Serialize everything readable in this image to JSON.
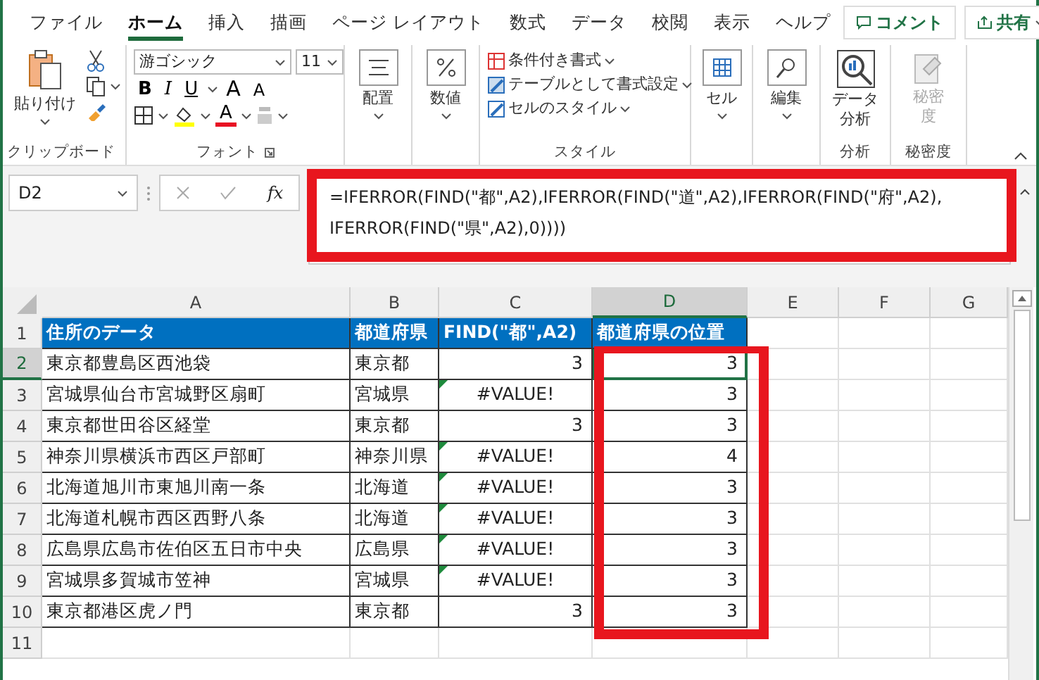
{
  "menu_tabs": [
    {
      "label": "ファイル",
      "selected": false
    },
    {
      "label": "ホーム",
      "selected": true
    },
    {
      "label": "挿入",
      "selected": false
    },
    {
      "label": "描画",
      "selected": false
    },
    {
      "label": "ページ レイアウト",
      "selected": false
    },
    {
      "label": "数式",
      "selected": false
    },
    {
      "label": "データ",
      "selected": false
    },
    {
      "label": "校閲",
      "selected": false
    },
    {
      "label": "表示",
      "selected": false
    },
    {
      "label": "ヘルプ",
      "selected": false
    }
  ],
  "comment_button": "コメント",
  "share_button": "共有",
  "ribbon": {
    "clipboard": {
      "paste_label": "貼り付け",
      "group_label": "クリップボード"
    },
    "font": {
      "font_name": "游ゴシック",
      "font_size": "11",
      "bold": "B",
      "italic": "I",
      "underline": "U",
      "grow": "A",
      "shrink": "A",
      "font_color": "A",
      "group_label": "フォント"
    },
    "alignment": {
      "label": "配置"
    },
    "number": {
      "label": "数値"
    },
    "styles": {
      "items": [
        "条件付き書式",
        "テーブルとして書式設定",
        "セルのスタイル"
      ],
      "group_label": "スタイル"
    },
    "cells": {
      "label": "セル"
    },
    "editing": {
      "label": "編集"
    },
    "analysis": {
      "label_lines": [
        "データ",
        "分析"
      ],
      "group_label": "分析"
    },
    "sensitivity": {
      "label_lines": [
        "秘密",
        "度"
      ],
      "disabled": true,
      "group_label": "秘密度"
    }
  },
  "formula_bar": {
    "name_box": "D2",
    "fx": "fx",
    "formula_lines": [
      "=IFERROR(FIND(\"都\",A2),IFERROR(FIND(\"道\",A2),IFERROR(FIND(\"府\",A2),",
      "IFERROR(FIND(\"県\",A2),0))))"
    ]
  },
  "grid": {
    "columns": [
      {
        "label": "A",
        "selected": false
      },
      {
        "label": "B",
        "selected": false
      },
      {
        "label": "C",
        "selected": false
      },
      {
        "label": "D",
        "selected": true
      },
      {
        "label": "E",
        "selected": false
      },
      {
        "label": "F",
        "selected": false
      },
      {
        "label": "G",
        "selected": false
      }
    ],
    "rows": [
      {
        "header": "1",
        "selected": false,
        "cells": [
          {
            "text": "住所のデータ",
            "kind": "header",
            "flag": false
          },
          {
            "text": "都道府県",
            "kind": "header",
            "flag": false
          },
          {
            "text": "FIND(\"都\",A2)",
            "kind": "header",
            "flag": false
          },
          {
            "text": "都道府県の位置",
            "kind": "header",
            "flag": false
          }
        ]
      },
      {
        "header": "2",
        "selected": true,
        "cells": [
          {
            "text": "東京都豊島区西池袋",
            "kind": "text",
            "flag": false
          },
          {
            "text": "東京都",
            "kind": "text",
            "flag": false
          },
          {
            "text": "3",
            "kind": "number",
            "flag": false
          },
          {
            "text": "3",
            "kind": "number",
            "flag": false
          }
        ]
      },
      {
        "header": "3",
        "selected": false,
        "cells": [
          {
            "text": "宮城県仙台市宮城野区扇町",
            "kind": "text",
            "flag": false
          },
          {
            "text": "宮城県",
            "kind": "text",
            "flag": false
          },
          {
            "text": "#VALUE!",
            "kind": "error",
            "flag": true
          },
          {
            "text": "3",
            "kind": "number",
            "flag": false
          }
        ]
      },
      {
        "header": "4",
        "selected": false,
        "cells": [
          {
            "text": "東京都世田谷区経堂",
            "kind": "text",
            "flag": false
          },
          {
            "text": "東京都",
            "kind": "text",
            "flag": false
          },
          {
            "text": "3",
            "kind": "number",
            "flag": false
          },
          {
            "text": "3",
            "kind": "number",
            "flag": false
          }
        ]
      },
      {
        "header": "5",
        "selected": false,
        "cells": [
          {
            "text": "神奈川県横浜市西区戸部町",
            "kind": "text",
            "flag": false
          },
          {
            "text": "神奈川県",
            "kind": "text",
            "flag": false
          },
          {
            "text": "#VALUE!",
            "kind": "error",
            "flag": true
          },
          {
            "text": "4",
            "kind": "number",
            "flag": false
          }
        ]
      },
      {
        "header": "6",
        "selected": false,
        "cells": [
          {
            "text": "北海道旭川市東旭川南一条",
            "kind": "text",
            "flag": false
          },
          {
            "text": "北海道",
            "kind": "text",
            "flag": false
          },
          {
            "text": "#VALUE!",
            "kind": "error",
            "flag": true
          },
          {
            "text": "3",
            "kind": "number",
            "flag": false
          }
        ]
      },
      {
        "header": "7",
        "selected": false,
        "cells": [
          {
            "text": "北海道札幌市西区西野八条",
            "kind": "text",
            "flag": false
          },
          {
            "text": "北海道",
            "kind": "text",
            "flag": false
          },
          {
            "text": "#VALUE!",
            "kind": "error",
            "flag": true
          },
          {
            "text": "3",
            "kind": "number",
            "flag": false
          }
        ]
      },
      {
        "header": "8",
        "selected": false,
        "cells": [
          {
            "text": "広島県広島市佐伯区五日市中央",
            "kind": "text",
            "flag": false
          },
          {
            "text": "広島県",
            "kind": "text",
            "flag": false
          },
          {
            "text": "#VALUE!",
            "kind": "error",
            "flag": true
          },
          {
            "text": "3",
            "kind": "number",
            "flag": false
          }
        ]
      },
      {
        "header": "9",
        "selected": false,
        "cells": [
          {
            "text": "宮城県多賀城市笠神",
            "kind": "text",
            "flag": false
          },
          {
            "text": "宮城県",
            "kind": "text",
            "flag": false
          },
          {
            "text": "#VALUE!",
            "kind": "error",
            "flag": true
          },
          {
            "text": "3",
            "kind": "number",
            "flag": false
          }
        ]
      },
      {
        "header": "10",
        "selected": false,
        "cells": [
          {
            "text": "東京都港区虎ノ門",
            "kind": "text",
            "flag": false
          },
          {
            "text": "東京都",
            "kind": "text",
            "flag": false
          },
          {
            "text": "3",
            "kind": "number",
            "flag": false
          },
          {
            "text": "3",
            "kind": "number",
            "flag": false
          }
        ]
      },
      {
        "header": "11",
        "selected": false
      }
    ]
  }
}
